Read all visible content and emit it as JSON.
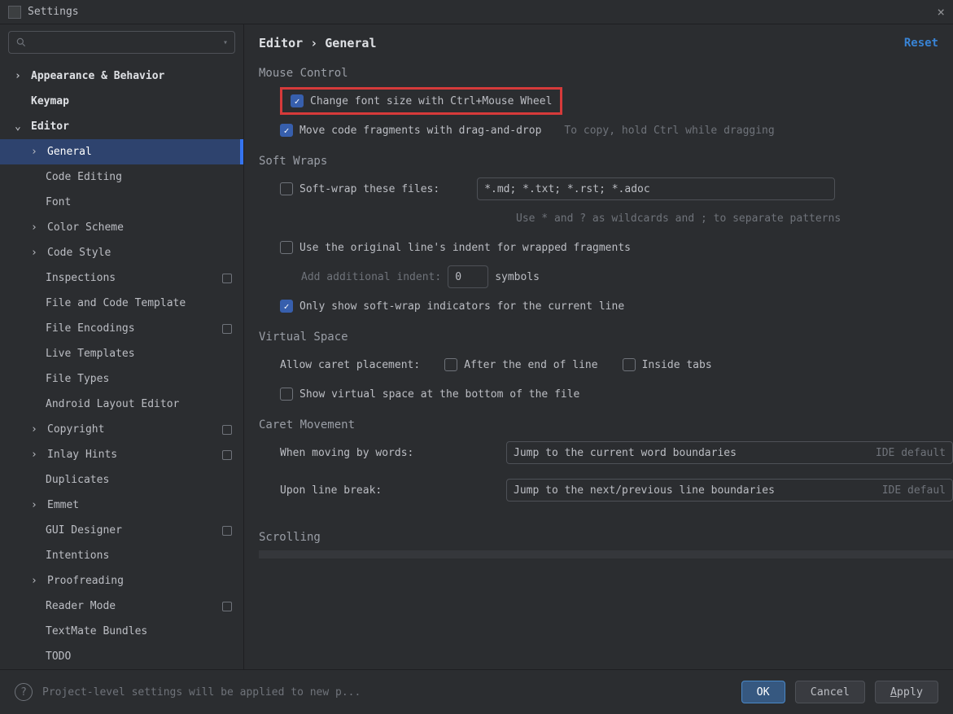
{
  "window": {
    "title": "Settings",
    "close_label": "×"
  },
  "sidebar": {
    "search_placeholder": "",
    "items": [
      {
        "label": "Appearance & Behavior",
        "level": 1,
        "chev": ">",
        "badge": false,
        "selected": false
      },
      {
        "label": "Keymap",
        "level": 1,
        "chev": "",
        "badge": false,
        "selected": false
      },
      {
        "label": "Editor",
        "level": 1,
        "chev": "v",
        "badge": false,
        "selected": false
      },
      {
        "label": "General",
        "level": 2,
        "chev": ">",
        "badge": false,
        "selected": true
      },
      {
        "label": "Code Editing",
        "level": 2,
        "chev": "",
        "badge": false,
        "selected": false
      },
      {
        "label": "Font",
        "level": 2,
        "chev": "",
        "badge": false,
        "selected": false
      },
      {
        "label": "Color Scheme",
        "level": 2,
        "chev": ">",
        "badge": false,
        "selected": false
      },
      {
        "label": "Code Style",
        "level": 2,
        "chev": ">",
        "badge": false,
        "selected": false
      },
      {
        "label": "Inspections",
        "level": 2,
        "chev": "",
        "badge": true,
        "selected": false
      },
      {
        "label": "File and Code Template",
        "level": 2,
        "chev": "",
        "badge": false,
        "selected": false
      },
      {
        "label": "File Encodings",
        "level": 2,
        "chev": "",
        "badge": true,
        "selected": false
      },
      {
        "label": "Live Templates",
        "level": 2,
        "chev": "",
        "badge": false,
        "selected": false
      },
      {
        "label": "File Types",
        "level": 2,
        "chev": "",
        "badge": false,
        "selected": false
      },
      {
        "label": "Android Layout Editor",
        "level": 2,
        "chev": "",
        "badge": false,
        "selected": false
      },
      {
        "label": "Copyright",
        "level": 2,
        "chev": ">",
        "badge": true,
        "selected": false
      },
      {
        "label": "Inlay Hints",
        "level": 2,
        "chev": ">",
        "badge": true,
        "selected": false
      },
      {
        "label": "Duplicates",
        "level": 2,
        "chev": "",
        "badge": false,
        "selected": false
      },
      {
        "label": "Emmet",
        "level": 2,
        "chev": ">",
        "badge": false,
        "selected": false
      },
      {
        "label": "GUI Designer",
        "level": 2,
        "chev": "",
        "badge": true,
        "selected": false
      },
      {
        "label": "Intentions",
        "level": 2,
        "chev": "",
        "badge": false,
        "selected": false
      },
      {
        "label": "Proofreading",
        "level": 2,
        "chev": ">",
        "badge": false,
        "selected": false
      },
      {
        "label": "Reader Mode",
        "level": 2,
        "chev": "",
        "badge": true,
        "selected": false
      },
      {
        "label": "TextMate Bundles",
        "level": 2,
        "chev": "",
        "badge": false,
        "selected": false
      },
      {
        "label": "TODO",
        "level": 2,
        "chev": "",
        "badge": false,
        "selected": false
      }
    ]
  },
  "header": {
    "breadcrumb": "Editor › General",
    "reset": "Reset"
  },
  "sections": {
    "mouse": {
      "title": "Mouse Control",
      "change_font": "Change font size with Ctrl+Mouse Wheel",
      "move_fragments": "Move code fragments with drag-and-drop",
      "move_hint": "To copy, hold Ctrl while dragging"
    },
    "softwraps": {
      "title": "Soft Wraps",
      "wrap_files": "Soft-wrap these files:",
      "wrap_value": "*.md; *.txt; *.rst; *.adoc",
      "wrap_hint": "Use * and ? as wildcards and ; to separate patterns",
      "use_indent": "Use the original line's indent for wrapped fragments",
      "add_indent_label": "Add additional indent:",
      "add_indent_value": "0",
      "add_indent_suffix": "symbols",
      "only_current": "Only show soft-wrap indicators for the current line"
    },
    "virtual": {
      "title": "Virtual Space",
      "caret_label": "Allow caret placement:",
      "after_eol": "After the end of line",
      "inside_tabs": "Inside tabs",
      "bottom_space": "Show virtual space at the bottom of the file"
    },
    "caret": {
      "title": "Caret Movement",
      "by_words": "When moving by words:",
      "by_words_val": "Jump to the current word boundaries",
      "by_words_hint": "IDE default",
      "line_break": "Upon line break:",
      "line_break_val": "Jump to the next/previous line boundaries",
      "line_break_hint": "IDE defaul"
    },
    "scrolling": {
      "title": "Scrolling"
    }
  },
  "footer": {
    "help": "?",
    "msg": "Project-level settings will be applied to new p...",
    "ok": "OK",
    "cancel": "Cancel",
    "apply": "Apply"
  }
}
